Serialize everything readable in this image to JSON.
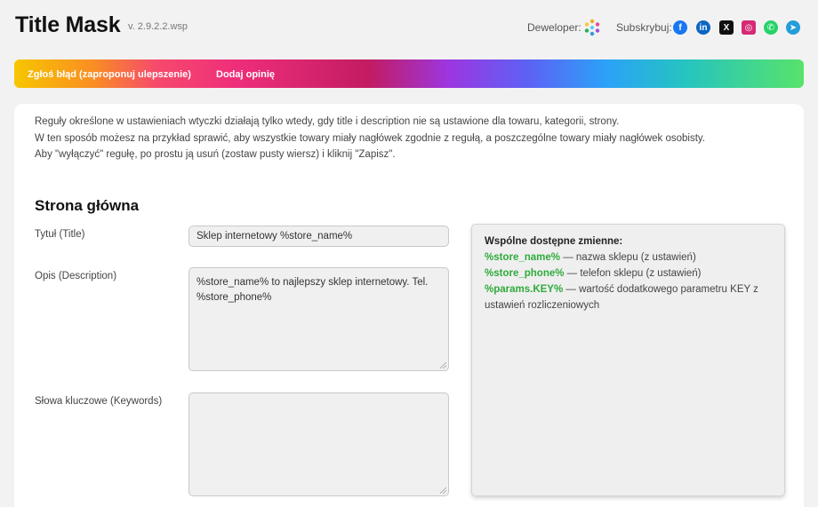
{
  "header": {
    "title": "Title Mask",
    "version": "v. 2.9.2.2.wsp",
    "developer_label": "Deweloper:",
    "developer_icon": "developer-logo-icon",
    "subscribe_label": "Subskrybuj:",
    "socials": [
      {
        "name": "facebook-icon",
        "glyph": "f",
        "color": "#1877f2"
      },
      {
        "name": "linkedin-icon",
        "glyph": "in",
        "color": "#0a66c2"
      },
      {
        "name": "x-icon",
        "glyph": "X",
        "color": "#111111"
      },
      {
        "name": "instagram-icon",
        "glyph": "◎",
        "color": "#d62976"
      },
      {
        "name": "whatsapp-icon",
        "glyph": "✆",
        "color": "#25d366"
      },
      {
        "name": "telegram-icon",
        "glyph": "➤",
        "color": "#229ed9"
      }
    ]
  },
  "bar": {
    "report_bug": "Zgłoś błąd (zaproponuj ulepszenie)",
    "add_review": "Dodaj opinię"
  },
  "intro": [
    "Reguły określone w ustawieniach wtyczki działają tylko wtedy, gdy title i description nie są ustawione dla towaru, kategorii, strony.",
    "W ten sposób możesz na przykład sprawić, aby wszystkie towary miały nagłówek zgodnie z regułą, a poszczególne towary miały nagłówek osobisty.",
    "Aby \"wyłączyć\" regułę, po prostu ją usuń (zostaw pusty wiersz) i kliknij \"Zapisz\"."
  ],
  "section": {
    "title": "Strona główna",
    "title_label": "Tytuł (Title)",
    "title_value": "Sklep internetowy %store_name%",
    "description_label": "Opis (Description)",
    "description_value": "%store_name% to najlepszy sklep internetowy. Tel. %store_phone%",
    "keywords_label": "Słowa kluczowe (Keywords)",
    "keywords_value": ""
  },
  "variables": {
    "title": "Wspólne dostępne zmienne:",
    "items": [
      {
        "name": "%store_name%",
        "desc": " — nazwa sklepu (z ustawień)"
      },
      {
        "name": "%store_phone%",
        "desc": " — telefon sklepu (z ustawień)"
      },
      {
        "name": "%params.KEY%",
        "desc": " — wartość dodatkowego parametru KEY z ustawień rozliczeniowych"
      }
    ]
  },
  "colors": {
    "accent_green": "#2eab3b",
    "page_bg": "#f2f2f2"
  }
}
